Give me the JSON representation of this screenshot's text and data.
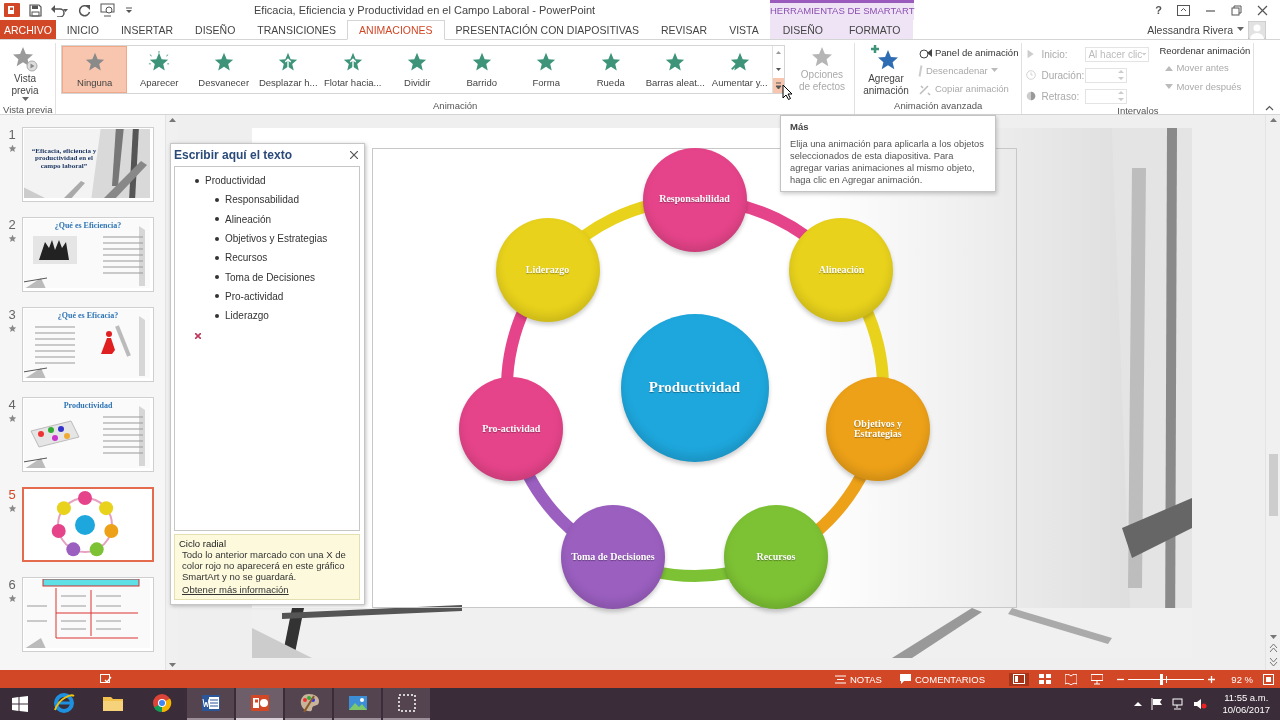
{
  "window": {
    "title": "Eficacia, Eficiencia y Productividad en el Campo Laboral - PowerPoint",
    "contextual_header": "HERRAMIENTAS DE SMARTART",
    "help": "?",
    "user": "Alessandra Rivera"
  },
  "tabs": [
    {
      "label": "ARCHIVO",
      "kind": "file",
      "selected": false
    },
    {
      "label": "INICIO",
      "kind": "normal",
      "selected": false
    },
    {
      "label": "INSERTAR",
      "kind": "normal",
      "selected": false
    },
    {
      "label": "DISEÑO",
      "kind": "normal",
      "selected": false
    },
    {
      "label": "TRANSICIONES",
      "kind": "normal",
      "selected": false
    },
    {
      "label": "ANIMACIONES",
      "kind": "normal",
      "selected": true
    },
    {
      "label": "PRESENTACIÓN CON DIAPOSITIVAS",
      "kind": "normal",
      "selected": false
    },
    {
      "label": "REVISAR",
      "kind": "normal",
      "selected": false
    },
    {
      "label": "VISTA",
      "kind": "normal",
      "selected": false
    },
    {
      "label": "DISEÑO",
      "kind": "contextual",
      "selected": false
    },
    {
      "label": "FORMATO",
      "kind": "contextual",
      "selected": false
    }
  ],
  "ribbon": {
    "preview": {
      "label": "Vista previa",
      "group_label": "Vista previa"
    },
    "animation": {
      "group_label": "Animación",
      "gallery": [
        {
          "label": "Ninguna",
          "selected": true
        },
        {
          "label": "Aparecer",
          "selected": false
        },
        {
          "label": "Desvanecer",
          "selected": false
        },
        {
          "label": "Desplazar h...",
          "selected": false
        },
        {
          "label": "Flotar hacia...",
          "selected": false
        },
        {
          "label": "Dividir",
          "selected": false
        },
        {
          "label": "Barrido",
          "selected": false
        },
        {
          "label": "Forma",
          "selected": false
        },
        {
          "label": "Rueda",
          "selected": false
        },
        {
          "label": "Barras aleat...",
          "selected": false
        },
        {
          "label": "Aumentar y...",
          "selected": false
        }
      ],
      "effect_options": {
        "label": "Opciones de efectos",
        "disabled": true
      }
    },
    "advanced": {
      "group_label": "Animación avanzada",
      "add": {
        "label": "Agregar animación"
      },
      "commands": [
        {
          "label": "Panel de animación",
          "disabled": false
        },
        {
          "label": "Desencadenar",
          "disabled": true
        },
        {
          "label": "Copiar animación",
          "disabled": true
        }
      ]
    },
    "timing": {
      "group_label": "Intervalos",
      "fields": [
        {
          "label": "Inicio:",
          "value": "Al hacer clic",
          "disabled": true
        },
        {
          "label": "Duración:",
          "disabled": true
        },
        {
          "label": "Retraso:",
          "disabled": true
        }
      ],
      "reorder_title": "Reordenar animación",
      "commands": [
        {
          "label": "Mover antes",
          "disabled": true
        },
        {
          "label": "Mover después",
          "disabled": true
        }
      ]
    }
  },
  "tooltip": {
    "title": "Más",
    "text": "Elija una animación para aplicarla a los objetos seleccionados de esta diapositiva. Para agregar varias animaciones al mismo objeto, haga clic en Agregar animación."
  },
  "thumbnails": [
    {
      "number": "1",
      "kind": "title",
      "title": "“Eficacia, eficiencia y productividad en el campo laboral”",
      "selected": false
    },
    {
      "number": "2",
      "kind": "text_image",
      "title": "¿Qué es Eficiencia?",
      "selected": false
    },
    {
      "number": "3",
      "kind": "text_image",
      "title": "¿Qué es Eficacia?",
      "selected": false
    },
    {
      "number": "4",
      "kind": "text_image",
      "title": "Productividad",
      "selected": false
    },
    {
      "number": "5",
      "kind": "diagram",
      "selected": true
    },
    {
      "number": "6",
      "kind": "table",
      "selected": false
    }
  ],
  "text_pane": {
    "title": "Escribir aquí el texto",
    "items": [
      {
        "text": "Productividad",
        "children": [
          {
            "text": "Responsabilidad"
          },
          {
            "text": "Alineación"
          },
          {
            "text": "Objetivos y Estrategias"
          },
          {
            "text": "Recursos"
          },
          {
            "text": "Toma de Decisiones"
          },
          {
            "text": "Pro-actividad"
          },
          {
            "text": "Liderazgo"
          }
        ]
      }
    ],
    "info": {
      "title": "Ciclo radial",
      "text": "Todo lo anterior marcado con una X de color rojo no aparecerá en este gráfico SmartArt y no se guardará.",
      "link": "Obtener más información"
    }
  },
  "slide": {
    "center": "Productividad",
    "nodes": [
      {
        "label": "Responsabilidad",
        "color": "#e6448a"
      },
      {
        "label": "Alineación",
        "color": "#e8d21c"
      },
      {
        "label": "Objetivos y Estrategias",
        "color": "#eda118"
      },
      {
        "label": "Recursos",
        "color": "#7dc234"
      },
      {
        "label": "Toma de Decisiones",
        "color": "#9b5fc0"
      },
      {
        "label": "Pro-actividad",
        "color": "#e6448a"
      },
      {
        "label": "Liderazgo",
        "color": "#e8d21c"
      }
    ]
  },
  "status_bar": {
    "notes": "NOTAS",
    "comments": "COMENTARIOS",
    "views": [
      {
        "kind": "normal",
        "selected": true
      },
      {
        "kind": "sorter",
        "selected": false
      },
      {
        "kind": "reading",
        "selected": false
      },
      {
        "kind": "slideshow",
        "selected": false
      }
    ],
    "zoom": {
      "level": 0.44,
      "reading": "92 %"
    }
  },
  "taskbar": {
    "apps": [
      {
        "kind": "ie",
        "running": false,
        "active": false
      },
      {
        "kind": "explorer",
        "running": false,
        "active": false
      },
      {
        "kind": "chrome",
        "running": false,
        "active": false
      },
      {
        "kind": "word",
        "running": true,
        "active": false
      },
      {
        "kind": "powerpoint",
        "running": true,
        "active": true
      },
      {
        "kind": "paint",
        "running": true,
        "active": false
      },
      {
        "kind": "photos",
        "running": true,
        "active": false
      },
      {
        "kind": "snip",
        "running": true,
        "active": false
      }
    ],
    "time": "11:55 a.m.",
    "date": "10/06/2017"
  }
}
